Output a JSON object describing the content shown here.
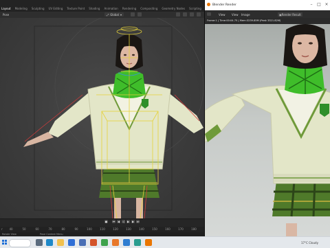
{
  "main_window": {
    "workspace_tabs": [
      "Layout",
      "Modeling",
      "Sculpting",
      "UV Editing",
      "Texture Paint",
      "Shading",
      "Animation",
      "Rendering",
      "Compositing",
      "Geometry Nodes",
      "Scripting"
    ],
    "active_tab": "Layout",
    "view_label": "Pose",
    "transform_orientation": "Global",
    "timeline_ticks": [
      "40",
      "50",
      "60",
      "70",
      "80",
      "90",
      "100",
      "110",
      "120",
      "130",
      "140",
      "150",
      "160",
      "170",
      "180"
    ],
    "timeline_first_label": "r",
    "status_left": "Rotate View",
    "status_mid": "Pose Context Menu"
  },
  "render_window": {
    "title": "Blender Render",
    "menu_view": "View",
    "menu_view2": "View",
    "menu_image": "Image",
    "result_label": "Render Result",
    "info": "Frame:1 | Time:00:04.75 | Mem:3239.85M (Peak 3321.82M)"
  },
  "taskbar": {
    "weather": "17°C  Cloudy",
    "apps": [
      {
        "name": "task-view-icon",
        "color": "#5a6b7d"
      },
      {
        "name": "edge-icon",
        "color": "#1e88c8"
      },
      {
        "name": "file-explorer-icon",
        "color": "#f2c14e"
      },
      {
        "name": "mail-icon",
        "color": "#2f6fd6"
      },
      {
        "name": "store-icon",
        "color": "#4a6fb5"
      },
      {
        "name": "office-icon",
        "color": "#d4542a"
      },
      {
        "name": "chrome-icon",
        "color": "#3fa34d"
      },
      {
        "name": "firefox-icon",
        "color": "#e8782a"
      },
      {
        "name": "photos-icon",
        "color": "#2f7dd1"
      },
      {
        "name": "app-icon",
        "color": "#2a9d8f"
      },
      {
        "name": "blender-icon",
        "color": "#ea7600"
      }
    ]
  },
  "colors": {
    "sweater": "#e3e6c8",
    "tartan": "#4f7a2a",
    "scarf": "#3fbd2a",
    "rig": "#e5d23a",
    "hair": "#1a1613"
  }
}
